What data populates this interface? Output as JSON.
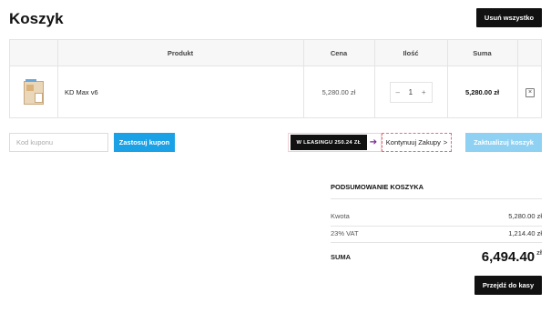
{
  "page": {
    "title": "Koszyk",
    "clear_cart_label": "Usuń wszystko"
  },
  "table": {
    "headers": {
      "product": "Produkt",
      "price": "Cena",
      "quantity": "Ilość",
      "subtotal": "Suma"
    },
    "items": [
      {
        "name": "KD Max v6",
        "price": "5,280.00 zł",
        "quantity": "1",
        "subtotal": "5,280.00 zł",
        "minus": "–",
        "plus": "+",
        "remove": "×"
      }
    ]
  },
  "coupon": {
    "placeholder": "Kod kuponu",
    "apply_label": "Zastosuj kupon"
  },
  "leasing": {
    "label": "W LEASINGU 250.24 ZŁ",
    "arrow": "➔"
  },
  "continue_label": "Kontynuuj Zakupy",
  "continue_chevron": ">",
  "update_label": "Zaktualizuj koszyk",
  "totals": {
    "title": "PODSUMOWANIE KOSZYKA",
    "amount_label": "Kwota",
    "amount_value": "5,280.00 zł",
    "vat_label": "23% VAT",
    "vat_value": "1,214.40 zł",
    "sum_label": "SUMA",
    "sum_value": "6,494.40",
    "sum_currency": "zł"
  },
  "checkout_label": "Przejdź do kasy",
  "colors": {
    "accent_blue": "#1aa1e6",
    "update_blue": "#8fd1f3",
    "dark": "#111111",
    "leasing_arrow": "#7b2a90"
  }
}
